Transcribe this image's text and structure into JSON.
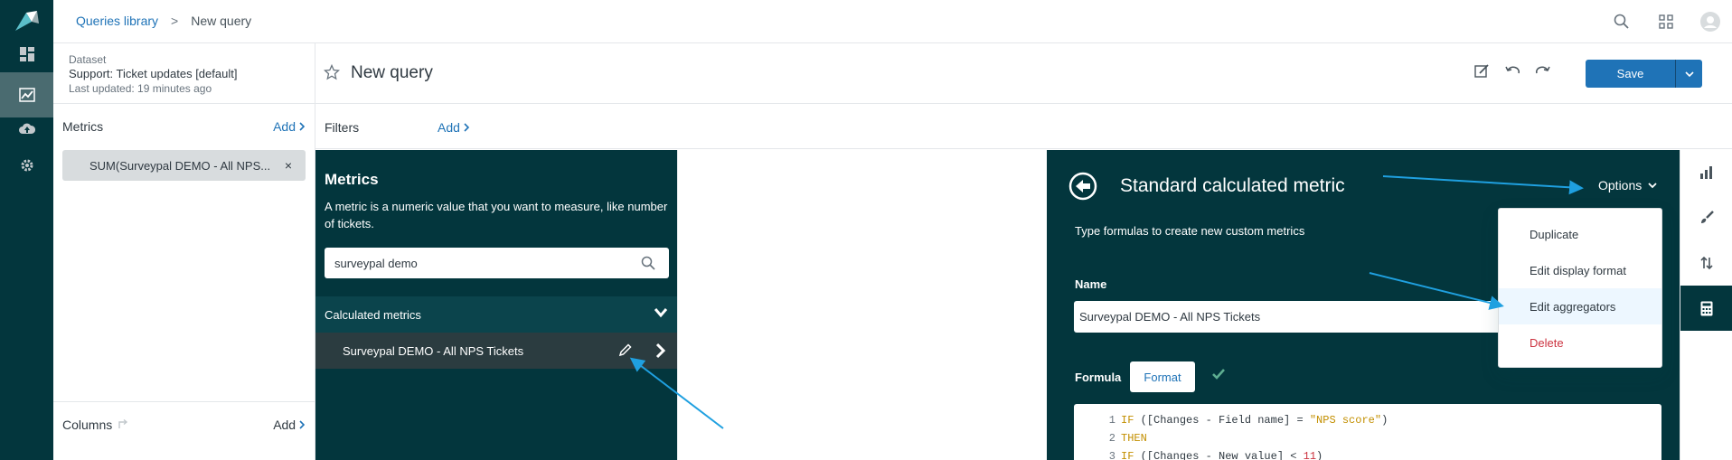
{
  "breadcrumb": {
    "library": "Queries library",
    "separator": ">",
    "current": "New query"
  },
  "dataset": {
    "label": "Dataset",
    "name": "Support: Ticket updates [default]",
    "updated": "Last updated: 19 minutes ago"
  },
  "query": {
    "title": "New query",
    "save_label": "Save"
  },
  "metrics_row": {
    "label": "Metrics",
    "add_label": "Add"
  },
  "metric_pill": {
    "text": "SUM(Surveypal DEMO - All NPS...",
    "remove": "×"
  },
  "columns_row": {
    "label": "Columns",
    "add_label": "Add"
  },
  "filters_row": {
    "label": "Filters",
    "add_label": "Add"
  },
  "metrics_panel": {
    "title": "Metrics",
    "description": "A metric is a numeric value that you want to measure, like number of tickets.",
    "search_value": "surveypal demo",
    "category": "Calculated metrics",
    "item": "Surveypal DEMO - All NPS Tickets"
  },
  "calc_panel": {
    "title": "Standard calculated metric",
    "options_label": "Options",
    "subtitle": "Type formulas to create new custom metrics",
    "name_label": "Name",
    "name_value": "Surveypal DEMO - All NPS Tickets",
    "formula_label": "Formula",
    "format_button": "Format"
  },
  "code_lines": [
    {
      "num": "1",
      "a": "IF ",
      "b": "([Changes - Field name] = ",
      "c": "\"NPS score\"",
      "d": ")"
    },
    {
      "num": "2",
      "a": "THEN",
      "b": "",
      "c": "",
      "d": ""
    },
    {
      "num": "3",
      "a": "IF ",
      "b": "([Changes - New value] < ",
      "c": "11",
      "d": ")"
    }
  ],
  "options_menu": {
    "duplicate": "Duplicate",
    "edit_display_format": "Edit display format",
    "edit_aggregators": "Edit aggregators",
    "delete": "Delete"
  },
  "colors": {
    "nav_dark": "#03363d",
    "accent_blue": "#1f73b7",
    "danger": "#cc3340",
    "annotation_arrow": "#1fa0e0",
    "check_green": "#5eae91"
  }
}
